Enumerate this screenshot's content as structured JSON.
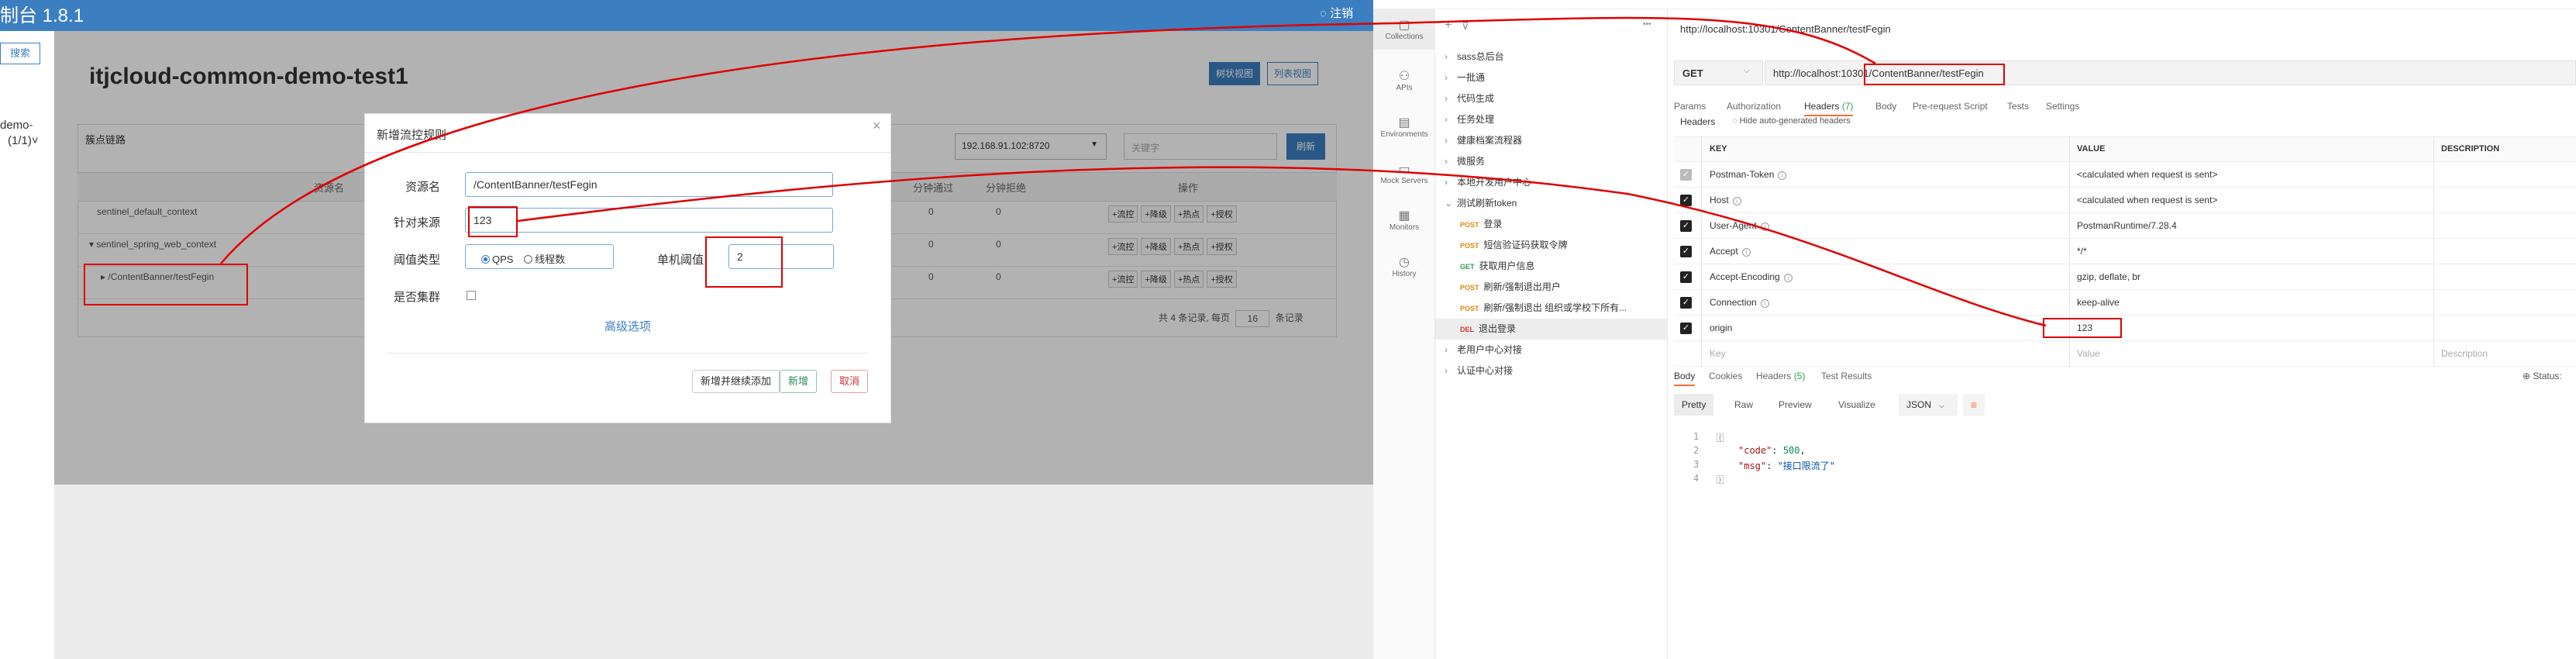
{
  "sentinel": {
    "title_partial": "制台 1.8.1",
    "top_right_partial": "◌ 注销",
    "search_button": "搜索",
    "side_item_line1": "demo-",
    "side_item_line2": "(1/1)˅",
    "page_title": "itjcloud-common-demo-test1",
    "view_tree": "树状视图",
    "view_list": "列表视图",
    "card_title": "簇点链路",
    "ip_select_value": "192.168.91.102:8720",
    "keyword_placeholder": "关键字",
    "refresh_button": "刷新",
    "table_headers": {
      "resource": "资源名",
      "pass_qps": "分钟通过",
      "reject_qps": "分钟拒绝",
      "ops": "操作"
    },
    "rows": [
      {
        "name": "sentinel_default_context",
        "pass": "0",
        "reject": "0"
      },
      {
        "name": "sentinel_spring_web_context",
        "pass": "0",
        "reject": "0"
      },
      {
        "name": "/ContentBanner/testFegin",
        "pass": "0",
        "reject": "0"
      }
    ],
    "row_ops": [
      "+流控",
      "+降级",
      "+热点",
      "+授权"
    ],
    "pager": {
      "prefix": "共 4 条记录, 每页",
      "page_size": "16",
      "suffix": "条记录"
    },
    "modal": {
      "title": "新增流控规则",
      "close": "×",
      "labels": {
        "resource": "资源名",
        "limit_app": "针对来源",
        "grade": "阈值类型",
        "count": "单机阈值",
        "cluster": "是否集群"
      },
      "resource_value": "/ContentBanner/testFegin",
      "limit_app_value": "123",
      "grade_options": [
        "QPS",
        "线程数"
      ],
      "grade_selected": "QPS",
      "count_value": "2",
      "advanced_link": "高级选项",
      "buttons": {
        "save_continue": "新增并继续添加",
        "add": "新增",
        "cancel": "取消"
      }
    }
  },
  "postman": {
    "rail": [
      {
        "label": "Collections",
        "icon": "collections-icon",
        "glyph": "▢"
      },
      {
        "label": "APIs",
        "icon": "apis-icon",
        "glyph": "⚇"
      },
      {
        "label": "Environments",
        "icon": "environments-icon",
        "glyph": "▤"
      },
      {
        "label": "Mock Servers",
        "icon": "mock-servers-icon",
        "glyph": "▭"
      },
      {
        "label": "Monitors",
        "icon": "monitors-icon",
        "glyph": "▦"
      },
      {
        "label": "History",
        "icon": "history-icon",
        "glyph": "◷"
      }
    ],
    "sidebar": {
      "add": "+",
      "filter": "⊽",
      "more": "•••",
      "items": [
        {
          "kind": "folder",
          "label": "sass总后台",
          "open": false,
          "indent": 0
        },
        {
          "kind": "folder",
          "label": "一批通",
          "open": false,
          "indent": 0
        },
        {
          "kind": "folder",
          "label": "代码生成",
          "open": false,
          "indent": 0
        },
        {
          "kind": "folder",
          "label": "任务处理",
          "open": false,
          "indent": 0
        },
        {
          "kind": "folder",
          "label": "健康档案流程器",
          "open": false,
          "indent": 0
        },
        {
          "kind": "folder",
          "label": "微服务",
          "open": false,
          "indent": 0
        },
        {
          "kind": "folder",
          "label": "本地开发用户中心",
          "open": false,
          "indent": 0
        },
        {
          "kind": "folder",
          "label": "测试刷新token",
          "open": true,
          "indent": 0
        },
        {
          "kind": "req",
          "method": "POST",
          "label": "登录",
          "indent": 1
        },
        {
          "kind": "req",
          "method": "POST",
          "label": "短信验证码获取令牌",
          "indent": 1
        },
        {
          "kind": "req",
          "method": "GET",
          "label": "获取用户信息",
          "indent": 1
        },
        {
          "kind": "req",
          "method": "POST",
          "label": "刷新/强制退出用户",
          "indent": 1
        },
        {
          "kind": "req",
          "method": "POST",
          "label": "刷新/强制退出 组织或学校下所有...",
          "indent": 1
        },
        {
          "kind": "req",
          "method": "DEL",
          "label": "退出登录",
          "indent": 1,
          "selected": true
        },
        {
          "kind": "folder",
          "label": "老用户中心对接",
          "open": false,
          "indent": 0
        },
        {
          "kind": "folder",
          "label": "认证中心对接",
          "open": false,
          "indent": 0
        }
      ]
    },
    "request": {
      "url_heading": "http://localhost:10301/ContentBanner/testFegin",
      "method": "GET",
      "url": "http://localhost:10301/ContentBanner/testFegin"
    },
    "tabs": [
      {
        "label": "Params"
      },
      {
        "label": "Authorization"
      },
      {
        "label": "Headers",
        "badge": "(7)"
      },
      {
        "label": "Body"
      },
      {
        "label": "Pre-request Script"
      },
      {
        "label": "Tests"
      },
      {
        "label": "Settings"
      }
    ],
    "headers_sub": "Headers",
    "hide_auto": "Hide auto-generated headers",
    "header_cols": {
      "key": "KEY",
      "value": "VALUE",
      "desc": "DESCRIPTION"
    },
    "header_rows": [
      {
        "key": "Postman-Token",
        "value": "<calculated when request is sent>",
        "info": true,
        "dim": true
      },
      {
        "key": "Host",
        "value": "<calculated when request is sent>",
        "info": true,
        "dim": false
      },
      {
        "key": "User-Agent",
        "value": "PostmanRuntime/7.28.4",
        "info": true,
        "dim": false
      },
      {
        "key": "Accept",
        "value": "*/*",
        "info": true,
        "dim": false
      },
      {
        "key": "Accept-Encoding",
        "value": "gzip, deflate, br",
        "info": true,
        "dim": false
      },
      {
        "key": "Connection",
        "value": "keep-alive",
        "info": true,
        "dim": false
      },
      {
        "key": "origin",
        "value": "123",
        "info": false,
        "dim": false
      }
    ],
    "placeholder_row": {
      "key": "Key",
      "value": "Value",
      "desc": "Description"
    },
    "response_tabs": [
      {
        "label": "Body"
      },
      {
        "label": "Cookies"
      },
      {
        "label": "Headers",
        "badge": "(5)"
      },
      {
        "label": "Test Results"
      }
    ],
    "status_partial": "Status:",
    "format_buttons": [
      "Pretty",
      "Raw",
      "Preview",
      "Visualize"
    ],
    "json_select": "JSON",
    "response_lines": [
      {
        "n": "1",
        "text": "{"
      },
      {
        "n": "2",
        "key": "\"code\"",
        "val": "500",
        "type": "num"
      },
      {
        "n": "3",
        "key": "\"msg\"",
        "val": "\"接口限流了\"",
        "type": "str"
      },
      {
        "n": "4",
        "text": "}"
      }
    ]
  },
  "colors": {
    "sentinel_blue": "#3c7fc1",
    "annotation_red": "#e00000",
    "postman_orange": "#ff6c37"
  }
}
